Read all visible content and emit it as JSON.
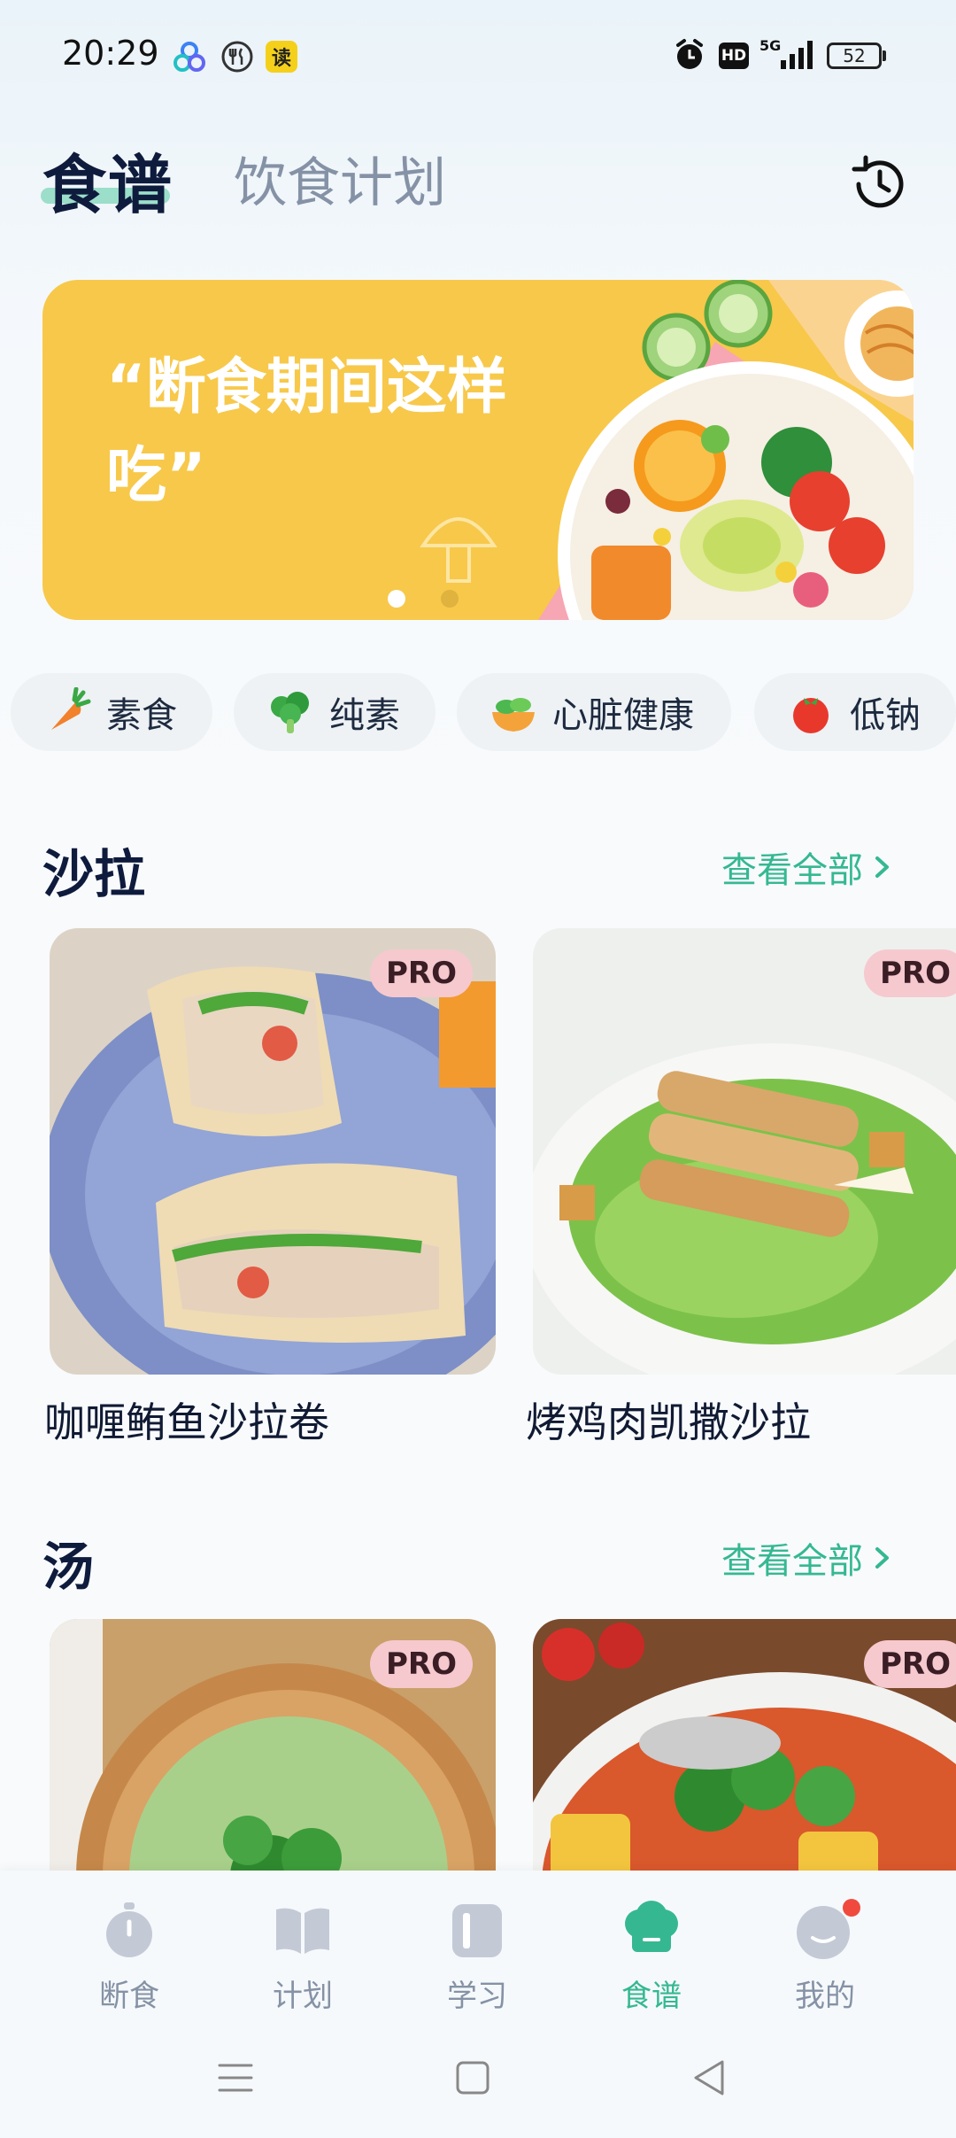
{
  "status_bar": {
    "time": "20:29",
    "app_badge_text": "读",
    "network": "5G",
    "hd": "HD",
    "battery": "52"
  },
  "header": {
    "tabs": [
      "食谱",
      "饮食计划"
    ],
    "active_tab": "食谱",
    "history_icon": "history-icon"
  },
  "banner": {
    "text": "“断食期间这样吃”",
    "slide_count": 2,
    "active_slide": 1,
    "colors": {
      "background": "#f7c84a",
      "accent": "#f7a6b4"
    }
  },
  "categories": [
    {
      "label": "素食",
      "icon": "carrot-icon"
    },
    {
      "label": "纯素",
      "icon": "broccoli-icon"
    },
    {
      "label": "心脏健康",
      "icon": "salad-bowl-icon"
    },
    {
      "label": "低钠",
      "icon": "tomato-icon"
    }
  ],
  "sections": [
    {
      "title": "沙拉",
      "see_all": "查看全部",
      "recipes": [
        {
          "title": "咖喱鲔鱼沙拉卷",
          "badge": "PRO"
        },
        {
          "title": "烤鸡肉凯撒沙拉",
          "badge": "PRO"
        }
      ]
    },
    {
      "title": "汤",
      "see_all": "查看全部",
      "recipes": [
        {
          "title": "",
          "badge": "PRO"
        },
        {
          "title": "",
          "badge": "PRO"
        }
      ]
    }
  ],
  "bottom_nav": {
    "items": [
      {
        "label": "断食",
        "icon": "stopwatch-icon"
      },
      {
        "label": "计划",
        "icon": "book-icon"
      },
      {
        "label": "学习",
        "icon": "learn-icon"
      },
      {
        "label": "食谱",
        "icon": "chef-hat-icon"
      },
      {
        "label": "我的",
        "icon": "profile-icon"
      }
    ],
    "active": "食谱",
    "notification_dot_on": "我的"
  },
  "colors": {
    "accent_green": "#35b892",
    "title_navy": "#0e1b3d",
    "inactive_gray": "#8592a6",
    "pro_badge": "#f6c9cf"
  }
}
